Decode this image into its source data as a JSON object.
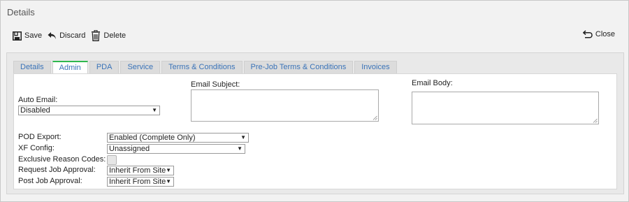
{
  "window": {
    "title": "Details"
  },
  "toolbar": {
    "save_label": "Save",
    "discard_label": "Discard",
    "delete_label": "Delete",
    "close_label": "Close"
  },
  "tabs": [
    "Details",
    "Admin",
    "PDA",
    "Service",
    "Terms & Conditions",
    "Pre-Job Terms & Conditions",
    "Invoices"
  ],
  "active_tab": "Admin",
  "form": {
    "auto_email": {
      "label": "Auto Email:",
      "value": "Disabled"
    },
    "email_subject": {
      "label": "Email Subject:",
      "value": ""
    },
    "email_body": {
      "label": "Email Body:",
      "value": ""
    },
    "pod_export": {
      "label": "POD Export:",
      "value": "Enabled (Complete Only)"
    },
    "xf_config": {
      "label": "XF Config:",
      "value": "Unassigned"
    },
    "exclusive_reason_codes": {
      "label": "Exclusive Reason Codes:",
      "checked": false
    },
    "request_job_approval": {
      "label": "Request Job Approval:",
      "value": "Inherit From Site"
    },
    "post_job_approval": {
      "label": "Post Job Approval:",
      "value": "Inherit From Site"
    }
  },
  "colors": {
    "tab_text": "#3a73b8",
    "active_tab_accent": "#2fb84f"
  }
}
